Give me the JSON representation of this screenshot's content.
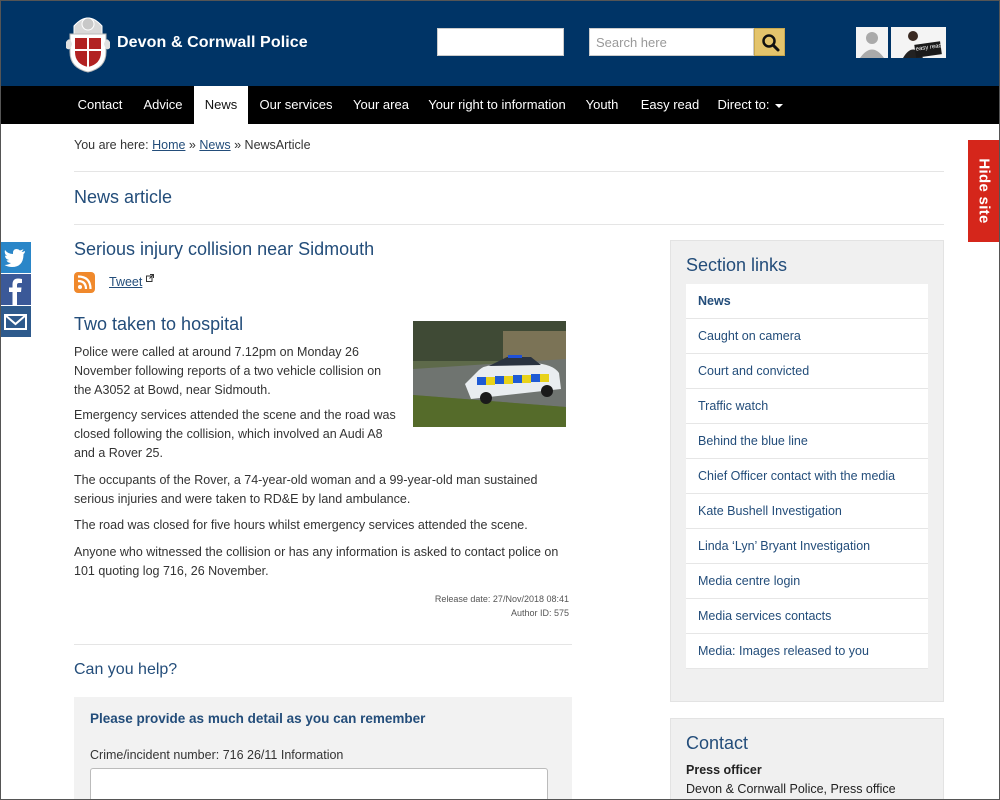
{
  "header": {
    "site_name": "Devon & Cornwall Police",
    "search_placeholder": "Search here",
    "easy_read_badge": "easy read",
    "colors": {
      "header_bg": "#003466",
      "search_button": "#e4c46c"
    }
  },
  "nav": {
    "items": [
      {
        "label": "Contact"
      },
      {
        "label": "Advice"
      },
      {
        "label": "News",
        "active": true
      },
      {
        "label": "Our services"
      },
      {
        "label": "Your area"
      },
      {
        "label": "Your right to information"
      },
      {
        "label": "Youth"
      },
      {
        "label": "Easy read"
      },
      {
        "label": "Direct to:",
        "dropdown": true
      }
    ]
  },
  "side_tabs": {
    "hide_site": "Hide site",
    "share_icons": [
      "twitter-icon",
      "facebook-icon",
      "email-icon"
    ]
  },
  "breadcrumb": {
    "prefix": "You are here:",
    "home": "Home",
    "sep1": "»",
    "news": "News",
    "sep2": "»",
    "current": "NewsArticle"
  },
  "page_title": "News article",
  "article": {
    "title": "Serious injury collision near Sidmouth",
    "tweet_label": "Tweet",
    "subheading": "Two taken to hospital",
    "paragraphs": [
      "Police were called at around 7.12pm on Monday 26 November following reports of a two vehicle collision on the A3052 at Bowd, near Sidmouth.",
      "Emergency services attended the scene and the road was closed following the collision, which involved an Audi A8 and a Rover 25.",
      "The occupants of the Rover, a 74-year-old woman and a 99-year-old man sustained serious injuries and were taken to RD&E by land ambulance.",
      "The road was closed for five hours whilst emergency services attended the scene.",
      "Anyone who witnessed the collision or has any information is asked to contact police on 101 quoting log 716, 26 November."
    ],
    "release_date": "Release date: 27/Nov/2018 08:41",
    "author_id": "Author ID: 575"
  },
  "help": {
    "title": "Can you help?",
    "form_title": "Please provide as much detail as you can remember",
    "field_label": "Crime/incident number: 716 26/11 Information",
    "field_value": ""
  },
  "sidebar": {
    "section_title": "Section links",
    "links": [
      {
        "label": "News",
        "current": true
      },
      {
        "label": "Caught on camera"
      },
      {
        "label": "Court and convicted"
      },
      {
        "label": "Traffic watch"
      },
      {
        "label": "Behind the blue line"
      },
      {
        "label": "Chief Officer contact with the media"
      },
      {
        "label": "Kate Bushell Investigation"
      },
      {
        "label": "Linda ‘Lyn’ Bryant Investigation"
      },
      {
        "label": "Media centre login"
      },
      {
        "label": "Media services contacts"
      },
      {
        "label": "Media: Images released to you"
      }
    ],
    "contact_title": "Contact",
    "contact_label": "Press officer",
    "contact_text": "Devon & Cornwall Police, Press office"
  }
}
